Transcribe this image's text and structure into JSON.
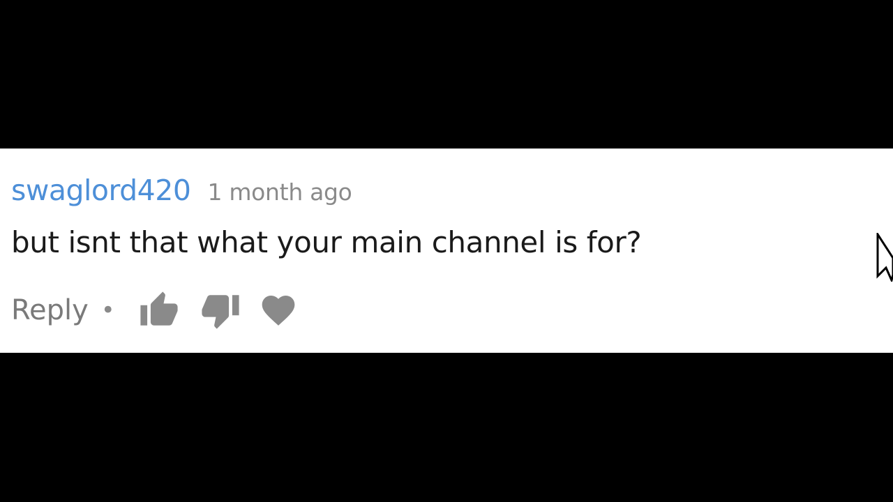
{
  "comment": {
    "author": "swaglord420",
    "timestamp": "1 month ago",
    "text": "but isnt that what your main channel is for?"
  },
  "actions": {
    "reply_label": "Reply",
    "separator": "•",
    "icons": [
      "thumbs-up-icon",
      "thumbs-down-icon",
      "heart-icon"
    ]
  },
  "colors": {
    "author": "#4d8fd8",
    "timestamp": "#8a8a8a",
    "text": "#1a1a1a",
    "icon": "#8a8a8a",
    "background_bars": "#000000",
    "comment_background": "#ffffff"
  }
}
